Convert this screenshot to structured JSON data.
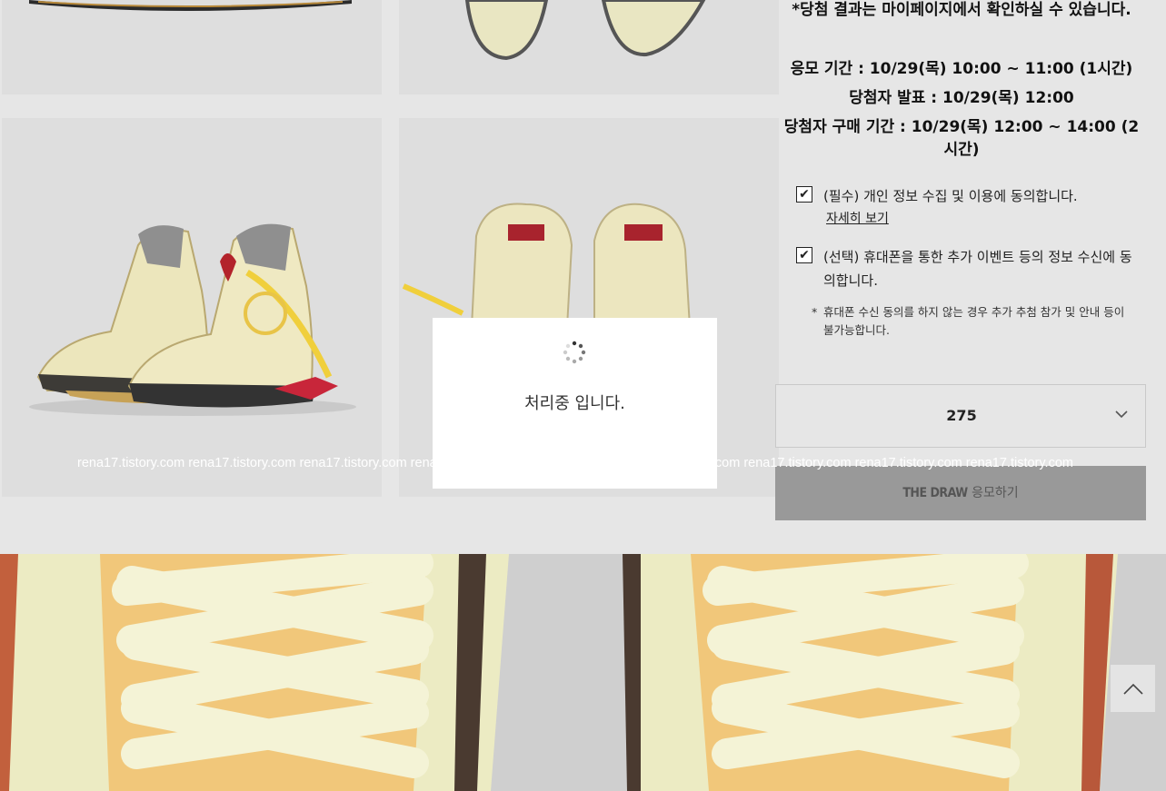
{
  "draw_info": {
    "notice": "*당첨 결과는 마이페이지에서 확인하실 수 있습니다.",
    "entry_period": "응모 기간 : 10/29(목) 10:00 ~ 11:00 (1시간)",
    "winner_announce": "당첨자 발표 : 10/29(목) 12:00",
    "purchase_period": "당첨자 구매 기간 : 10/29(목) 12:00 ~ 14:00 (2시간)"
  },
  "consents": [
    {
      "label": "(필수) 개인 정보 수집 및 이용에 동의합니다.",
      "checked": true,
      "link": "자세히 보기"
    },
    {
      "label": "(선택) 휴대폰을 통한 추가 이벤트 등의 정보 수신에 동의합니다.",
      "checked": true
    }
  ],
  "footnote": {
    "star": "*",
    "text": "휴대폰 수신 동의를 하지 않는 경우 추가 추첨 참가 및 안내 등이 불가능합니다."
  },
  "size_select": {
    "selected": "275"
  },
  "draw_button": {
    "brand": "THE DRAW",
    "label": " 응모하기"
  },
  "watermark": "rena17.tistory.com rena17.tistory.com rena17.tistory.com rena17.tistory.com rena17.tistory.com rena17.tistory.com rena17.tistory.com rena17.tistory.com rena17.tistory.com",
  "loading_modal": {
    "message": "처리중 입니다."
  },
  "icons": {
    "check": "✔",
    "dropdown": "chevron-down-icon",
    "scroll_top": "chevron-up-icon",
    "spinner": "loading-spinner-icon"
  },
  "colors": {
    "overlay": "#e6e6e6",
    "button_disabled": "#999999",
    "modal_bg": "#ffffff"
  }
}
